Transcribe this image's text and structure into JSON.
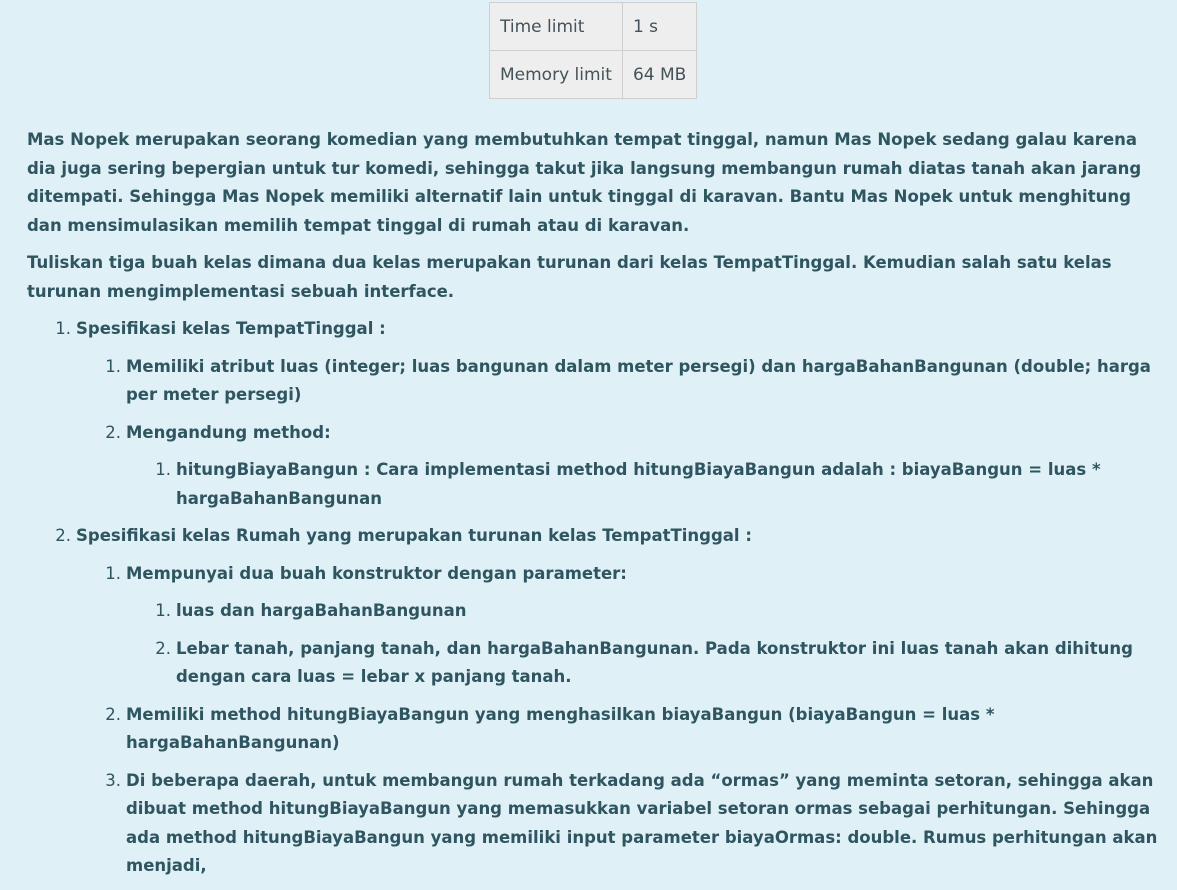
{
  "limits": [
    {
      "label": "Time limit",
      "value": "1 s"
    },
    {
      "label": "Memory limit",
      "value": "64 MB"
    }
  ],
  "intro": [
    "Mas Nopek merupakan seorang komedian yang membutuhkan tempat tinggal, namun Mas Nopek sedang galau karena dia juga sering bepergian untuk tur komedi, sehingga takut jika langsung membangun rumah diatas tanah akan jarang ditempati. Sehingga Mas Nopek memiliki alternatif lain untuk tinggal di karavan. Bantu Mas Nopek untuk menghitung dan mensimulasikan memilih tempat tinggal di rumah atau di karavan.",
    "Tuliskan tiga buah kelas dimana dua kelas merupakan turunan dari kelas TempatTinggal. Kemudian salah satu kelas turunan mengimplementasi sebuah interface."
  ],
  "spec": [
    {
      "num": "1.",
      "text": " Spesifikasi kelas TempatTinggal :",
      "items": [
        {
          "num": "1.",
          "text": "Memiliki atribut luas (integer; luas bangunan dalam meter persegi) dan hargaBahanBangunan (double; harga per meter persegi)"
        },
        {
          "num": "2.",
          "text": "Mengandung method:",
          "items": [
            {
              "num": "1.",
              "text": "hitungBiayaBangun : Cara implementasi method hitungBiayaBangun adalah : biayaBangun = luas * hargaBahanBangunan"
            }
          ]
        }
      ]
    },
    {
      "num": "2.",
      "text": "Spesifikasi kelas Rumah yang merupakan turunan kelas TempatTinggal :",
      "items": [
        {
          "num": "1.",
          "text": "Mempunyai dua buah konstruktor dengan parameter:",
          "items": [
            {
              "num": "1.",
              "text": "luas dan hargaBahanBangunan"
            },
            {
              "num": "2.",
              "text": "Lebar tanah, panjang tanah, dan hargaBahanBangunan. Pada konstruktor ini luas tanah akan dihitung dengan cara luas = lebar x panjang tanah."
            }
          ]
        },
        {
          "num": "2.",
          "text": "Memiliki method hitungBiayaBangun yang menghasilkan biayaBangun (biayaBangun = luas * hargaBahanBangunan)"
        },
        {
          "num": "3.",
          "text": "Di beberapa daerah, untuk membangun rumah terkadang ada “ormas” yang meminta setoran, sehingga akan dibuat method hitungBiayaBangun yang memasukkan variabel setoran ormas sebagai perhitungan. Sehingga ada method hitungBiayaBangun yang memiliki input parameter biayaOrmas: double. Rumus perhitungan akan menjadi,"
        }
      ]
    }
  ]
}
